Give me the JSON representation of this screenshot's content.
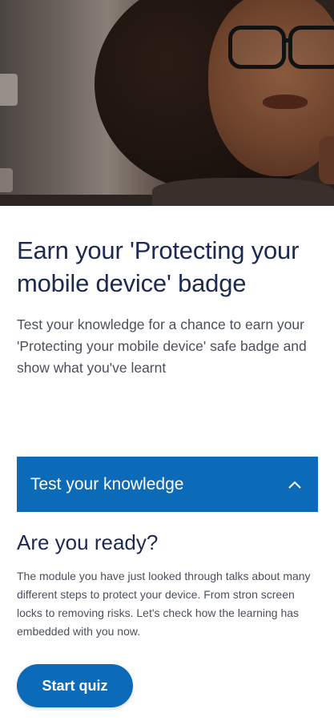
{
  "header": {
    "hero_image": "woman-with-glasses-photo"
  },
  "main": {
    "title": "Earn your 'Protecting your mobile device' badge",
    "intro": "Test your knowledge for a chance to earn your 'Protecting your mobile device' safe badge and show what you've learnt"
  },
  "accordion": {
    "label": "Test your knowledge",
    "expanded": true,
    "icon": "chevron-up-icon"
  },
  "quiz_section": {
    "title": "Are you ready?",
    "body": "The module you have just looked through talks about many different steps to protect your device. From stron screen locks to removing risks. Let's check how the learning has embedded with you now.",
    "start_label": "Start quiz"
  },
  "colors": {
    "accent": "#0b6bb8",
    "heading": "#1b2a4e",
    "body_text": "#4a4f5c",
    "background": "#ffffff"
  }
}
